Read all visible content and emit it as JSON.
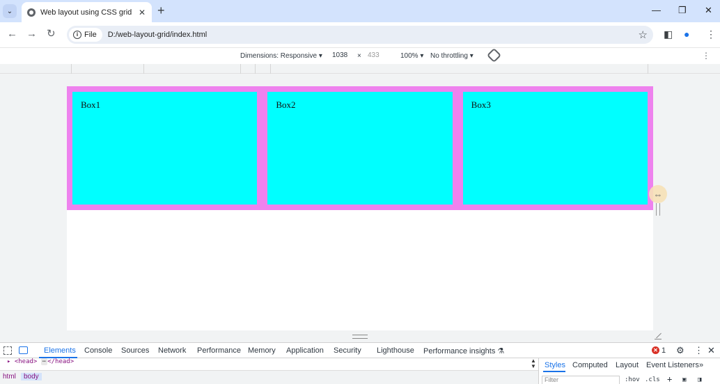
{
  "browser": {
    "tab_title": "Web layout using CSS grid",
    "tab_close": "✕",
    "new_tab": "+",
    "window": {
      "minimize": "—",
      "restore": "❐",
      "close": "✕"
    },
    "chip_label": "File",
    "url": "D:/web-layout-grid/index.html"
  },
  "device_toolbar": {
    "dimensions_label": "Dimensions: Responsive ▾",
    "width": "1038",
    "times": "×",
    "height": "433",
    "zoom": "100% ▾",
    "throttling": "No throttling ▾"
  },
  "page": {
    "colors": {
      "container": "#ee82ee",
      "box": "#00ffff"
    },
    "boxes": [
      {
        "label": "Box1"
      },
      {
        "label": "Box2"
      },
      {
        "label": "Box3"
      }
    ]
  },
  "devtools": {
    "tabs": [
      "Elements",
      "Console",
      "Sources",
      "Network",
      "Performance",
      "Memory",
      "Application",
      "Security",
      "Lighthouse",
      "Performance insights ⚗"
    ],
    "active_tab": "Elements",
    "error_count": "1",
    "dom_head": "<head>",
    "dom_head_close": "</head>",
    "breadcrumbs": [
      "html",
      "body"
    ],
    "styles_tabs": [
      "Styles",
      "Computed",
      "Layout",
      "Event Listeners",
      "»"
    ],
    "filter_placeholder": "Filter",
    "hov": ":hov",
    "cls": ".cls"
  }
}
